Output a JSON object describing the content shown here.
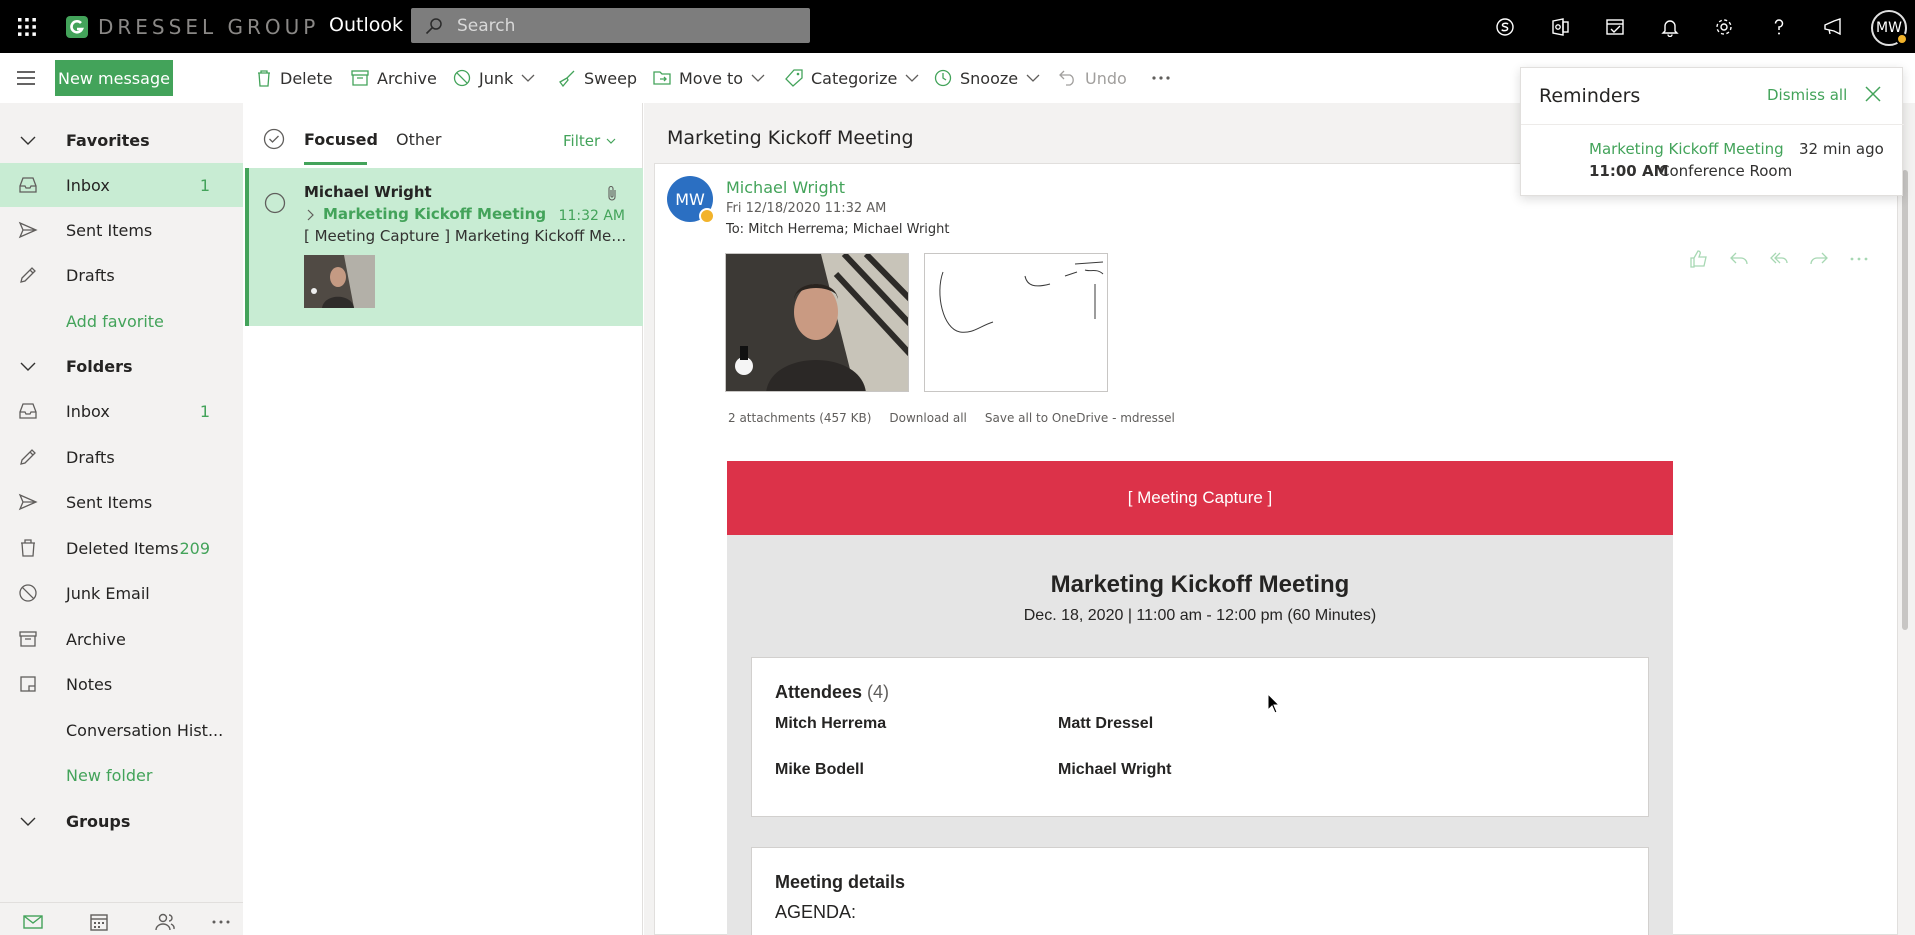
{
  "colors": {
    "accent": "#43a35a",
    "topbar": "#000000",
    "banner": "#dc3249",
    "selected": "#c8ecd3"
  },
  "topbar": {
    "brand": "DRESSEL GROUP",
    "app": "Outlook",
    "search_placeholder": "Search",
    "avatar": "MW",
    "icons": [
      "waffle-icon",
      "skype-icon",
      "office-icon",
      "my-day-icon",
      "bell-icon",
      "gear-icon",
      "help-icon",
      "feedback-icon"
    ]
  },
  "commandbar": {
    "new_message": "New message",
    "delete": "Delete",
    "archive": "Archive",
    "junk": "Junk",
    "sweep": "Sweep",
    "move_to": "Move to",
    "categorize": "Categorize",
    "snooze": "Snooze",
    "undo": "Undo"
  },
  "nav": {
    "favorites": "Favorites",
    "fav_items": [
      {
        "label": "Inbox",
        "count": "1"
      },
      {
        "label": "Sent Items",
        "count": ""
      },
      {
        "label": "Drafts",
        "count": ""
      }
    ],
    "add_favorite": "Add favorite",
    "folders": "Folders",
    "folder_items": [
      {
        "label": "Inbox",
        "count": "1"
      },
      {
        "label": "Drafts",
        "count": ""
      },
      {
        "label": "Sent Items",
        "count": ""
      },
      {
        "label": "Deleted Items",
        "count": "209"
      },
      {
        "label": "Junk Email",
        "count": ""
      },
      {
        "label": "Archive",
        "count": ""
      },
      {
        "label": "Notes",
        "count": ""
      },
      {
        "label": "Conversation Hist...",
        "count": ""
      }
    ],
    "new_folder": "New folder",
    "groups": "Groups"
  },
  "msglist": {
    "tab_focused": "Focused",
    "tab_other": "Other",
    "filter": "Filter",
    "item": {
      "sender": "Michael Wright",
      "subject": "Marketing Kickoff Meeting",
      "time": "11:32 AM",
      "preview": "[ Meeting Capture ] Marketing Kickoff Meeti..."
    }
  },
  "reading": {
    "subject": "Marketing Kickoff Meeting",
    "avatar": "MW",
    "sender": "Michael Wright",
    "date": "Fri 12/18/2020 11:32 AM",
    "to_label": "To:",
    "to": "Mitch Herrema; Michael Wright",
    "attachments_count": "2 attachments (457 KB)",
    "download_all": "Download all",
    "save_all": "Save all to OneDrive - mdressel",
    "body": {
      "banner": "[ Meeting Capture ]",
      "title": "Marketing Kickoff Meeting",
      "when": "Dec. 18, 2020 | 11:00 am - 12:00 pm (60 Minutes)",
      "attendees_label": "Attendees",
      "attendees_count": "(4)",
      "attendees": [
        "Mitch Herrema",
        "Matt Dressel",
        "Mike Bodell",
        "Michael Wright"
      ],
      "details_label": "Meeting details",
      "agenda": "AGENDA:"
    }
  },
  "reminders": {
    "title": "Reminders",
    "dismiss_all": "Dismiss all",
    "item_subject": "Marketing Kickoff Meeting",
    "item_ago": "32 min ago",
    "item_time": "11:00 AM",
    "item_location": "Conference Room"
  }
}
